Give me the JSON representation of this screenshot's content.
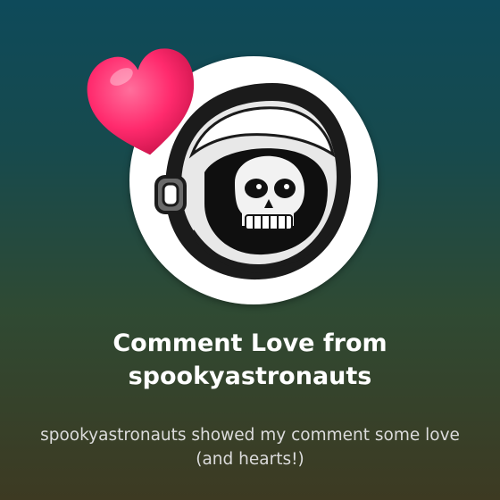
{
  "notification": {
    "title": "Comment Love from spookyastronauts",
    "message": "spookyastronauts showed my comment some love (and hearts!)",
    "avatar_icon": "skull-astronaut-helmet-icon",
    "reaction_icon": "heart-icon"
  },
  "colors": {
    "background_top": "#0e4a5a",
    "background_bottom": "#3d3a22",
    "heart": "#ff2a6d",
    "title_text": "#ffffff",
    "message_text": "#dcdcdc"
  }
}
